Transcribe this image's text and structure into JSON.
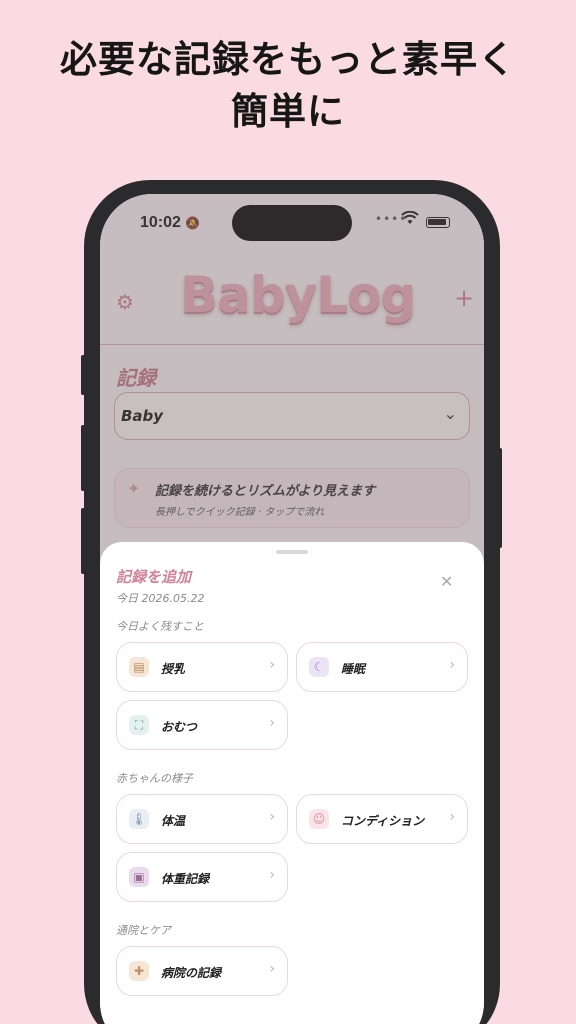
{
  "headline": {
    "line1": "必要な記録をもっと素早く",
    "line2": "簡単に"
  },
  "status_bar": {
    "time": "10:02",
    "signal_dots": "••••"
  },
  "app": {
    "logo_text": "BabyLog",
    "section_title": "記録",
    "select_value": "Baby",
    "banner_title": "記録を続けるとリズムがより見えます",
    "banner_subtitle": "長押しでクイック記録 · タップで流れ"
  },
  "sheet": {
    "title": "記録を追加",
    "date": "今日 2026.05.22",
    "groups": [
      {
        "label": "今日よく残すこと",
        "items": [
          "授乳",
          "睡眠",
          "おむつ"
        ]
      },
      {
        "label": "赤ちゃんの様子",
        "items": [
          "体温",
          "コンディション",
          "体重記録"
        ]
      },
      {
        "label": "通院とケア",
        "items": [
          "病院の記録"
        ]
      }
    ]
  },
  "icons": {
    "feeding": "bottle-icon",
    "sleep": "moon-icon",
    "diaper": "diaper-icon",
    "temperature": "thermometer-icon",
    "condition": "smiley-icon",
    "weight": "scale-icon",
    "hospital": "medical-cross-icon"
  },
  "colors": {
    "background": "#fadbe3",
    "accent": "#d28398",
    "card_border": "#f0d6dc"
  }
}
